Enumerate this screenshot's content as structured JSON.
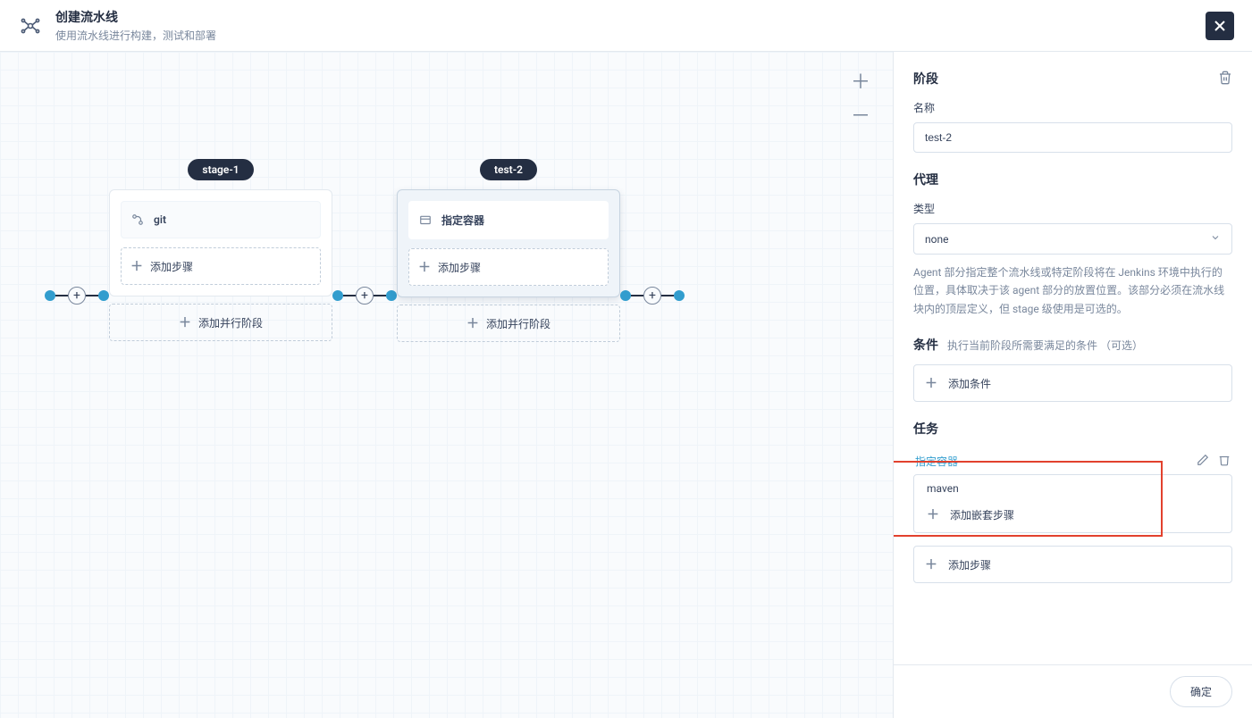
{
  "header": {
    "title": "创建流水线",
    "subtitle": "使用流水线进行构建，测试和部署"
  },
  "stages": [
    {
      "name": "stage-1",
      "steps": [
        {
          "label": "git",
          "icon": "git"
        }
      ],
      "addStep": "添加步骤",
      "addParallel": "添加并行阶段",
      "selected": false
    },
    {
      "name": "test-2",
      "steps": [
        {
          "label": "指定容器",
          "icon": "container"
        }
      ],
      "addStep": "添加步骤",
      "addParallel": "添加并行阶段",
      "selected": true
    }
  ],
  "panel": {
    "sectionStage": "阶段",
    "nameLabel": "名称",
    "nameValue": "test-2",
    "sectionAgent": "代理",
    "typeLabel": "类型",
    "typeValue": "none",
    "agentHelp": "Agent 部分指定整个流水线或特定阶段将在 Jenkins 环境中执行的位置，具体取决于该 agent 部分的放置位置。该部分必须在流水线块内的顶层定义，但 stage 级使用是可选的。",
    "sectionCondition": "条件",
    "conditionHint": "执行当前阶段所需要满足的条件 （可选）",
    "addCondition": "添加条件",
    "sectionTask": "任务",
    "taskLink": "指定容器",
    "taskSubLabel": "maven",
    "addNested": "添加嵌套步骤",
    "addStep": "添加步骤",
    "confirm": "确定"
  }
}
